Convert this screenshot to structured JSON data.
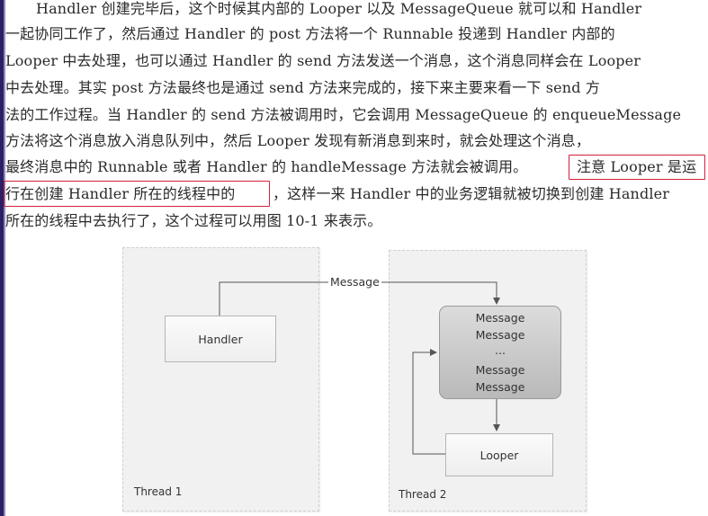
{
  "paragraph": {
    "lines": [
      "Handler 创建完毕后，这个时候其内部的 Looper 以及 MessageQueue 就可以和 Handler",
      "一起协同工作了，然后通过 Handler 的 post 方法将一个 Runnable 投递到 Handler 内部的",
      "Looper 中去处理，也可以通过 Handler 的 send 方法发送一个消息，这个消息同样会在 Looper",
      "中去处理。其实 post 方法最终也是通过 send 方法来完成的，接下来主要来看一下 send 方",
      "法的工作过程。当 Handler 的 send 方法被调用时，它会调用 MessageQueue 的 enqueueMessage",
      "方法将这个消息放入消息队列中，然后 Looper 发现有新消息到来时，就会处理这个消息，",
      "最终消息中的 Runnable 或者 Handler 的  handleMessage 方法就会被调用。",
      "行在创建 Handler 所在的线程中的",
      "，这样一来 Handler 中的业务逻辑就被切换到创建 Handler",
      "所在的线程中去执行了，这个过程可以用图 10-1 来表示。"
    ],
    "highlight_part1": "注意 Looper 是运"
  },
  "figure": {
    "thread1_label": "Thread 1",
    "thread2_label": "Thread 2",
    "handler_label": "Handler",
    "looper_label": "Looper",
    "message_arrow_label": "Message",
    "queue_items": [
      "Message",
      "Message",
      "...",
      "Message",
      "Message"
    ]
  },
  "colors": {
    "highlight": "#d3213a",
    "border": "#2a2066"
  }
}
